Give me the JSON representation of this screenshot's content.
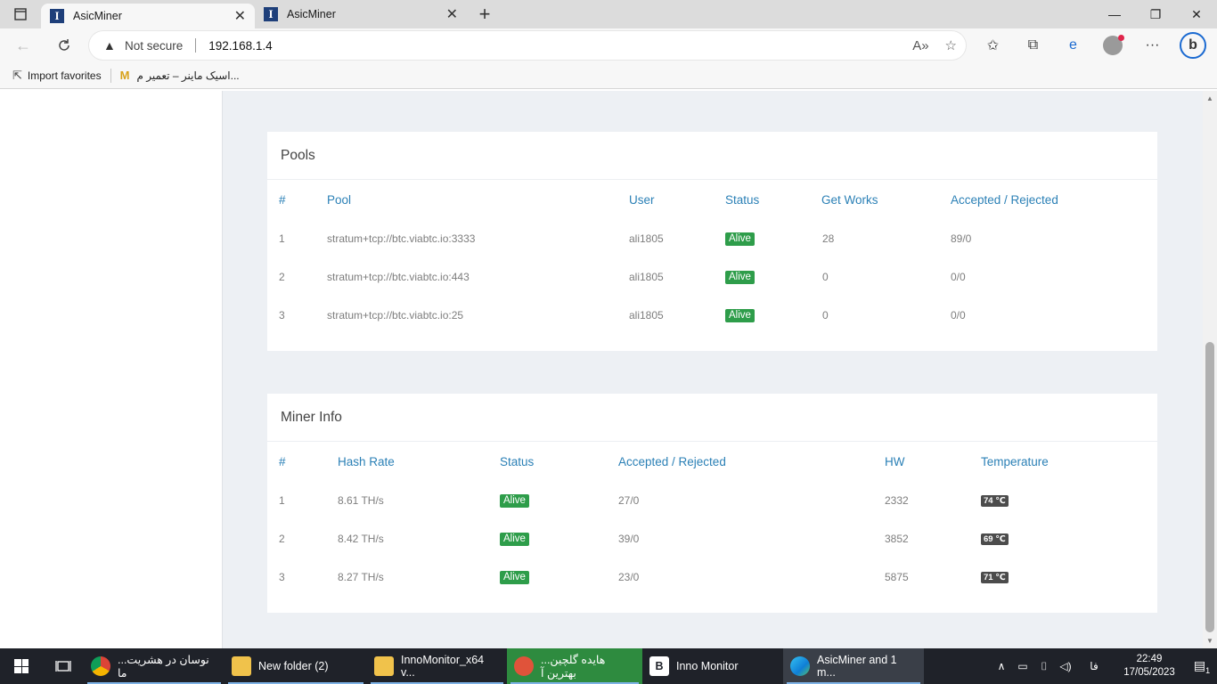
{
  "browser": {
    "tabs": [
      {
        "title": "AsicMiner",
        "active": true
      },
      {
        "title": "AsicMiner",
        "active": false
      }
    ],
    "address": {
      "security_label": "Not secure",
      "url": "192.168.1.4"
    },
    "favorites": [
      {
        "label": "Import favorites"
      },
      {
        "label": "اسیک ماینر – تعمیر م..."
      }
    ]
  },
  "pools": {
    "title": "Pools",
    "headers": [
      "#",
      "Pool",
      "User",
      "Status",
      "Get Works",
      "Accepted / Rejected"
    ],
    "rows": [
      {
        "num": "1",
        "pool": "stratum+tcp://btc.viabtc.io:3333",
        "user": "ali1805",
        "status": "Alive",
        "get_works": "28",
        "accepted_rejected": "89/0"
      },
      {
        "num": "2",
        "pool": "stratum+tcp://btc.viabtc.io:443",
        "user": "ali1805",
        "status": "Alive",
        "get_works": "0",
        "accepted_rejected": "0/0"
      },
      {
        "num": "3",
        "pool": "stratum+tcp://btc.viabtc.io:25",
        "user": "ali1805",
        "status": "Alive",
        "get_works": "0",
        "accepted_rejected": "0/0"
      }
    ]
  },
  "miner_info": {
    "title": "Miner Info",
    "headers": [
      "#",
      "Hash Rate",
      "Status",
      "Accepted / Rejected",
      "HW",
      "Temperature"
    ],
    "rows": [
      {
        "num": "1",
        "hash_rate": "8.61 TH/s",
        "status": "Alive",
        "accepted_rejected": "27/0",
        "hw": "2332",
        "temperature": "74 ℃"
      },
      {
        "num": "2",
        "hash_rate": "8.42 TH/s",
        "status": "Alive",
        "accepted_rejected": "39/0",
        "hw": "3852",
        "temperature": "69 ℃"
      },
      {
        "num": "3",
        "hash_rate": "8.27 TH/s",
        "status": "Alive",
        "accepted_rejected": "23/0",
        "hw": "5875",
        "temperature": "71 ℃"
      }
    ]
  },
  "taskbar": {
    "items": [
      {
        "label": "...نوسان در هشریت ما"
      },
      {
        "label": "New folder (2)"
      },
      {
        "label": "InnoMonitor_x64 v..."
      },
      {
        "label": "...هایده گلچین بهترین آ"
      },
      {
        "label": "Inno Monitor"
      },
      {
        "label": "AsicMiner and 1 m..."
      }
    ],
    "language": "فا",
    "time": "22:49",
    "date": "17/05/2023",
    "notifications": "1"
  },
  "colors": {
    "accent_header": "#2b80b6",
    "alive_badge": "#2e9d4a",
    "temp_badge": "#4c4c4c",
    "page_bg": "#edf0f4"
  }
}
